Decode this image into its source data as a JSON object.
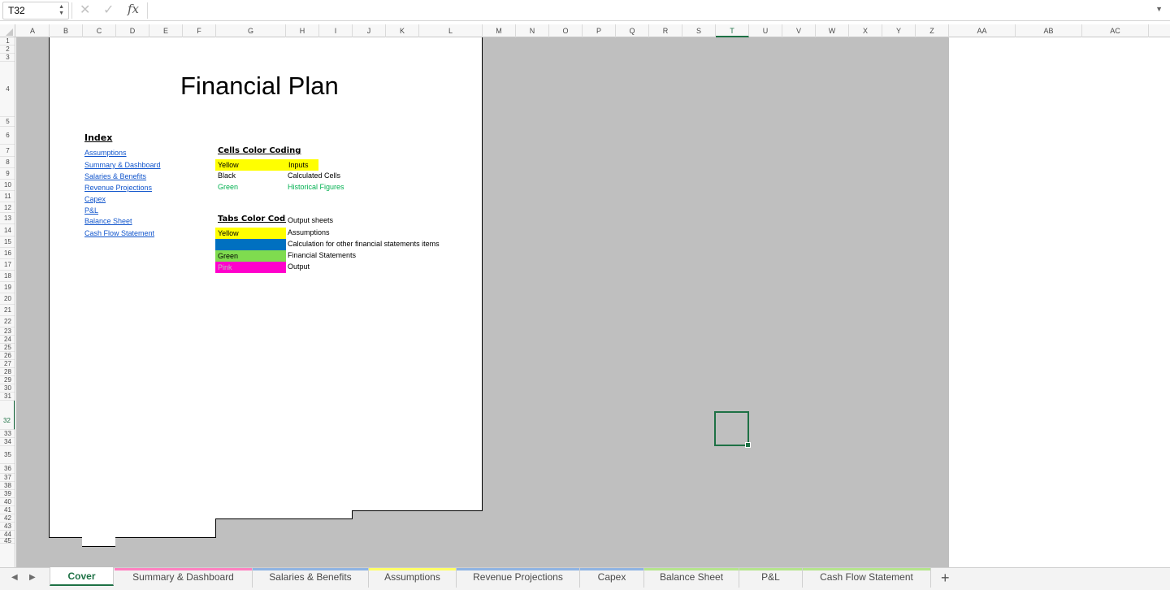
{
  "formula_bar": {
    "name_box": "T32",
    "fx_label": "fx",
    "formula": ""
  },
  "columns": [
    "A",
    "B",
    "C",
    "D",
    "E",
    "F",
    "G",
    "H",
    "I",
    "J",
    "K",
    "L",
    "M",
    "N",
    "O",
    "P",
    "Q",
    "R",
    "S",
    "T",
    "U",
    "V",
    "W",
    "X",
    "Y",
    "Z",
    "AA",
    "AB",
    "AC"
  ],
  "selected_column": "T",
  "rows": [
    "1",
    "2",
    "3",
    "4",
    "5",
    "6",
    "7",
    "8",
    "9",
    "10",
    "11",
    "12",
    "13",
    "14",
    "15",
    "16",
    "17",
    "18",
    "19",
    "20",
    "21",
    "22",
    "23",
    "24",
    "25",
    "26",
    "27",
    "28",
    "29",
    "30",
    "31",
    "32",
    "33",
    "34",
    "35",
    "36",
    "37",
    "38",
    "39",
    "40",
    "41",
    "42",
    "43",
    "44",
    "45"
  ],
  "selected_row": "32",
  "sheet": {
    "title": "Financial Plan",
    "index_header": "Index",
    "index_links": [
      "Assumptions",
      "Summary & Dashboard",
      "Salaries & Benefits",
      "Revenue Projections",
      "Capex",
      "P&L",
      "Balance Sheet",
      "Cash Flow Statement"
    ],
    "cells_coding": {
      "header": "Cells Color Coding",
      "rows": [
        {
          "label": "Yellow",
          "desc": "Inputs"
        },
        {
          "label": "Black",
          "desc": "Calculated Cells"
        },
        {
          "label": "Green",
          "desc": "Historical Figures"
        }
      ]
    },
    "tabs_coding": {
      "header": "Tabs Color Codi",
      "caption": "Output sheets",
      "rows": [
        {
          "label": "Yellow",
          "desc": "Assumptions"
        },
        {
          "label": "",
          "desc": "Calculation for other financial statements items"
        },
        {
          "label": "Green",
          "desc": "Financial Statements"
        },
        {
          "label": "Pink",
          "desc": "Output"
        }
      ]
    }
  },
  "colors": {
    "yellow": "#ffff00",
    "blue": "#0070c0",
    "green": "#7fdc4f",
    "pink": "#ff00cc",
    "green_text": "#00b050",
    "link": "#1155cc",
    "excel_green": "#1e7145",
    "gray_area": "#bfbfbf"
  },
  "tabs": [
    {
      "label": "Cover",
      "color": "#ffffff"
    },
    {
      "label": "Summary & Dashboard",
      "color": "#ff80c0"
    },
    {
      "label": "Salaries & Benefits",
      "color": "#8fb4e3"
    },
    {
      "label": "Assumptions",
      "color": "#ffff66"
    },
    {
      "label": "Revenue Projections",
      "color": "#8fb4e3"
    },
    {
      "label": "Capex",
      "color": "#8fb4e3"
    },
    {
      "label": "Balance Sheet",
      "color": "#b5e58c"
    },
    {
      "label": "P&L",
      "color": "#b5e58c"
    },
    {
      "label": "Cash Flow Statement",
      "color": "#b5e58c"
    }
  ],
  "active_tab": "Cover",
  "icons": {
    "cancel": "x-icon",
    "confirm": "check-icon",
    "add_sheet": "plus-icon",
    "prev": "triangle-left-icon",
    "next": "triangle-right-icon"
  }
}
